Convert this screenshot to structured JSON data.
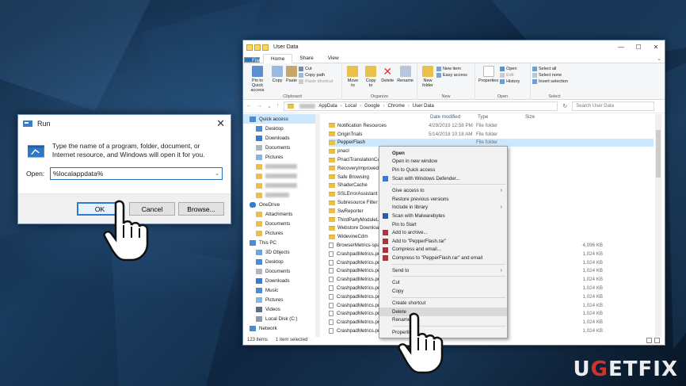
{
  "run": {
    "title": "Run",
    "description": "Type the name of a program, folder, document, or Internet resource, and Windows will open it for you.",
    "open_label": "Open:",
    "open_value": "%localappdata%",
    "ok": "OK",
    "cancel": "Cancel",
    "browse": "Browse..."
  },
  "explorer": {
    "title": "User Data",
    "tabs": [
      "File",
      "Home",
      "Share",
      "View"
    ],
    "ribbon": {
      "clipboard": {
        "label": "Clipboard",
        "pin": "Pin to Quick access",
        "copy": "Copy",
        "paste": "Paste",
        "cut": "Cut",
        "copy_path": "Copy path",
        "paste_shortcut": "Paste shortcut"
      },
      "organize": {
        "label": "Organize",
        "move_to": "Move to",
        "copy_to": "Copy to",
        "delete": "Delete",
        "rename": "Rename"
      },
      "new": {
        "label": "New",
        "new_folder": "New folder",
        "new_item": "New item",
        "easy_access": "Easy access"
      },
      "open": {
        "label": "Open",
        "properties": "Properties",
        "open": "Open",
        "edit": "Edit",
        "history": "History"
      },
      "select": {
        "label": "Select",
        "select_all": "Select all",
        "select_none": "Select none",
        "invert": "Invert selection"
      }
    },
    "path": [
      "AppData",
      "Local",
      "Google",
      "Chrome",
      "User Data"
    ],
    "search_placeholder": "Search User Data",
    "nav": {
      "quick_access": "Quick access",
      "desktop": "Desktop",
      "downloads": "Downloads",
      "documents": "Documents",
      "pictures": "Pictures",
      "onedrive": "OneDrive",
      "attachments": "Attachments",
      "od_documents": "Documents",
      "od_pictures": "Pictures",
      "this_pc": "This PC",
      "objects3d": "3D Objects",
      "pc_desktop": "Desktop",
      "pc_documents": "Documents",
      "pc_downloads": "Downloads",
      "music": "Music",
      "pc_pictures": "Pictures",
      "videos": "Videos",
      "local_disk": "Local Disk (C:)",
      "network": "Network"
    },
    "columns": {
      "date": "Date modified",
      "type": "Type",
      "size": "Size"
    },
    "rows": [
      {
        "name": "Notification Resources",
        "date": "4/29/2019 12:58 PM",
        "type": "File folder",
        "size": ""
      },
      {
        "name": "OriginTrials",
        "date": "5/14/2018 10:18 AM",
        "type": "File folder",
        "size": ""
      },
      {
        "name": "PepperFlash",
        "date": "",
        "type": "File folder",
        "size": ""
      },
      {
        "name": "pnacl",
        "date": "",
        "type": "",
        "size": ""
      },
      {
        "name": "PnaclTranslationCac",
        "date": "",
        "type": "",
        "size": ""
      },
      {
        "name": "RecoveryImproved",
        "date": "",
        "type": "",
        "size": ""
      },
      {
        "name": "Safe Browsing",
        "date": "",
        "type": "",
        "size": ""
      },
      {
        "name": "ShaderCache",
        "date": "",
        "type": "",
        "size": ""
      },
      {
        "name": "SSLErrorAssistant",
        "date": "",
        "type": "",
        "size": ""
      },
      {
        "name": "Subresource Filter",
        "date": "",
        "type": "",
        "size": ""
      },
      {
        "name": "SwReporter",
        "date": "",
        "type": "",
        "size": ""
      },
      {
        "name": "ThirdPartyModuleLi",
        "date": "",
        "type": "",
        "size": ""
      },
      {
        "name": "Webstore Download",
        "date": "",
        "type": "",
        "size": ""
      },
      {
        "name": "WidevineCdm",
        "date": "",
        "type": "",
        "size": ""
      },
      {
        "name": "BrowserMetrics-spar",
        "date": "",
        "type": "",
        "size": "4,096 KB"
      },
      {
        "name": "CrashpadMetrics.pm",
        "date": "",
        "type": "",
        "size": "1,024 KB"
      },
      {
        "name": "CrashpadMetrics.pm",
        "date": "",
        "type": "",
        "size": "1,024 KB"
      },
      {
        "name": "CrashpadMetrics.pm",
        "date": "",
        "type": "",
        "size": "1,024 KB"
      },
      {
        "name": "CrashpadMetrics.pm",
        "date": "",
        "type": "",
        "size": "1,024 KB"
      },
      {
        "name": "CrashpadMetrics.pm",
        "date": "",
        "type": "",
        "size": "1,024 KB"
      },
      {
        "name": "CrashpadMetrics.pm",
        "date": "",
        "type": "",
        "size": "1,024 KB"
      },
      {
        "name": "CrashpadMetrics.pm",
        "date": "",
        "type": "",
        "size": "1,024 KB"
      },
      {
        "name": "CrashpadMetrics.pm",
        "date": "",
        "type": "",
        "size": "1,024 KB"
      },
      {
        "name": "CrashpadMetrics.pm",
        "date": "",
        "type": "",
        "size": "1,024 KB"
      },
      {
        "name": "CrashpadMetrics.pm",
        "date": "",
        "type": "",
        "size": "1,024 KB"
      }
    ],
    "status_count": "123 items",
    "status_selected": "1 item selected"
  },
  "context_menu": {
    "items": [
      {
        "label": "Open",
        "bold": true
      },
      {
        "label": "Open in new window"
      },
      {
        "label": "Pin to Quick access"
      },
      {
        "label": "Scan with Windows Defender...",
        "icon": "shield"
      },
      {
        "sep": true
      },
      {
        "label": "Give access to",
        "sub": true
      },
      {
        "label": "Restore previous versions"
      },
      {
        "label": "Include in library",
        "sub": true
      },
      {
        "label": "Scan with Malwarebytes",
        "icon": "mb"
      },
      {
        "label": "Pin to Start"
      },
      {
        "label": "Add to archive...",
        "icon": "rar"
      },
      {
        "label": "Add to \"PepperFlash.rar\"",
        "icon": "rar"
      },
      {
        "label": "Compress and email...",
        "icon": "rar"
      },
      {
        "label": "Compress to \"PepperFlash.rar\" and email",
        "icon": "rar"
      },
      {
        "sep": true
      },
      {
        "label": "Send to",
        "sub": true
      },
      {
        "sep": true
      },
      {
        "label": "Cut"
      },
      {
        "label": "Copy"
      },
      {
        "sep": true
      },
      {
        "label": "Create shortcut"
      },
      {
        "label": "Delete",
        "hl": true
      },
      {
        "label": "Rename"
      },
      {
        "sep": true
      },
      {
        "label": "Properties"
      }
    ]
  },
  "watermark": {
    "pre": "U",
    "g": "G",
    "post": "ETFIX"
  },
  "colors": {
    "accent": "#1979ca",
    "selection": "#cce8ff",
    "folder": "#e8c14d"
  }
}
